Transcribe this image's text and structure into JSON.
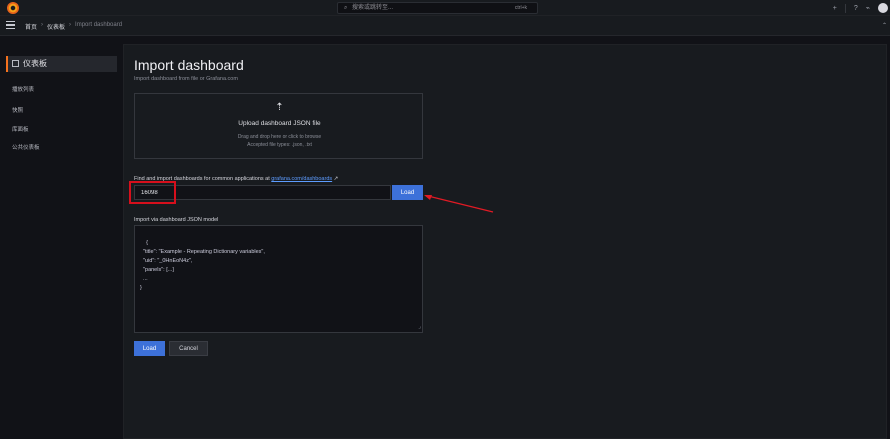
{
  "topbar": {
    "search_placeholder": "搜索或跳转至...",
    "shortcut": "ctrl+k",
    "add_label": "+",
    "help_icon": "help-icon",
    "rss_icon": "rss-icon"
  },
  "breadcrumbs": [
    "首页",
    "仪表板",
    "Import dashboard"
  ],
  "sidebar": {
    "title": "仪表板",
    "items": [
      "播放列表",
      "快照",
      "库面板",
      "公共仪表板"
    ]
  },
  "main": {
    "title": "Import dashboard",
    "subtitle": "Import dashboard from file or Grafana.com",
    "upload": {
      "title": "Upload dashboard JSON file",
      "hint": "Drag and drop here or click to browse",
      "accepted": "Accepted file types: .json, .txt"
    },
    "find_label": "Find and import dashboards for common applications at",
    "find_link": "grafana.com/dashboards",
    "dashboard_id": "16098",
    "load_label": "Load",
    "json_label": "Import via dashboard JSON model",
    "json_text": "{\n  \"title\": \"Example - Repeating Dictionary variables\",\n  \"uid\": \"_0HnEoN4z\",\n  \"panels\": [...]\n  ...\n}",
    "bottom_load": "Load",
    "cancel_label": "Cancel"
  }
}
